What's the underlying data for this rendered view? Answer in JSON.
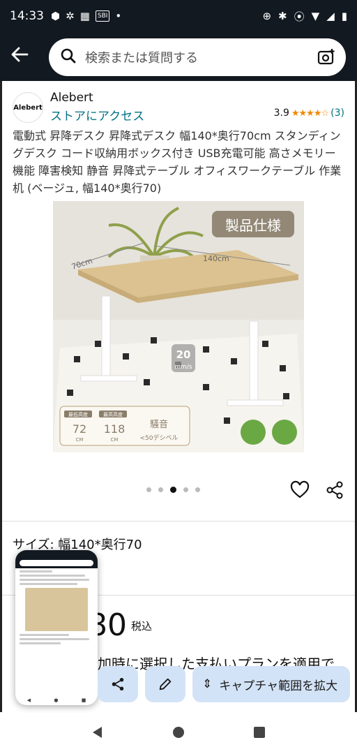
{
  "status_bar": {
    "time": "14:33",
    "left_icons": [
      "cube-icon",
      "pinwheel-icon",
      "calendar-icon",
      "sbi-icon",
      "dot-icon"
    ],
    "sbi_label": "SBI"
  },
  "search": {
    "placeholder": "検索または質問する"
  },
  "brand": {
    "logo_text": "Alebert",
    "name": "Alebert",
    "store_link": "ストアにアクセス",
    "rating": "3.9",
    "rating_count": "(3)"
  },
  "product": {
    "title": "電動式 昇降デスク 昇降式デスク 幅140*奥行70cm スタンディングデスク コード収納用ボックス付き USB充電可能 高さメモリー機能 障害検知 静音 昇降式テーブル オフィスワークテーブル 作業机 (ベージュ, 幅140*奥行70)",
    "image": {
      "badge": "製品仕様",
      "width_label": "140cm",
      "depth_label": "70cm",
      "speed_value": "20",
      "speed_unit": "mm/s",
      "min_height_label": "最低高度",
      "min_height_value": "72",
      "max_height_label": "最高高度",
      "max_height_value": "118",
      "unit": "CM",
      "noise_label": "騒音",
      "noise_value": "<50デシベル"
    },
    "carousel": {
      "count": 5,
      "active_index": 2
    },
    "size_label": "サイズ:",
    "size_value": "幅140*奥行70",
    "price": "80",
    "tax_label": "税込",
    "hidden_text": "追加時に選択した支払いプランを適用で"
  },
  "overlay": {
    "expand_label": "キャプチャ範囲を拡大"
  },
  "colors": {
    "header_bg": "#131921",
    "link": "#007185",
    "star": "#f08804",
    "control_bg": "#d3e3f7"
  }
}
